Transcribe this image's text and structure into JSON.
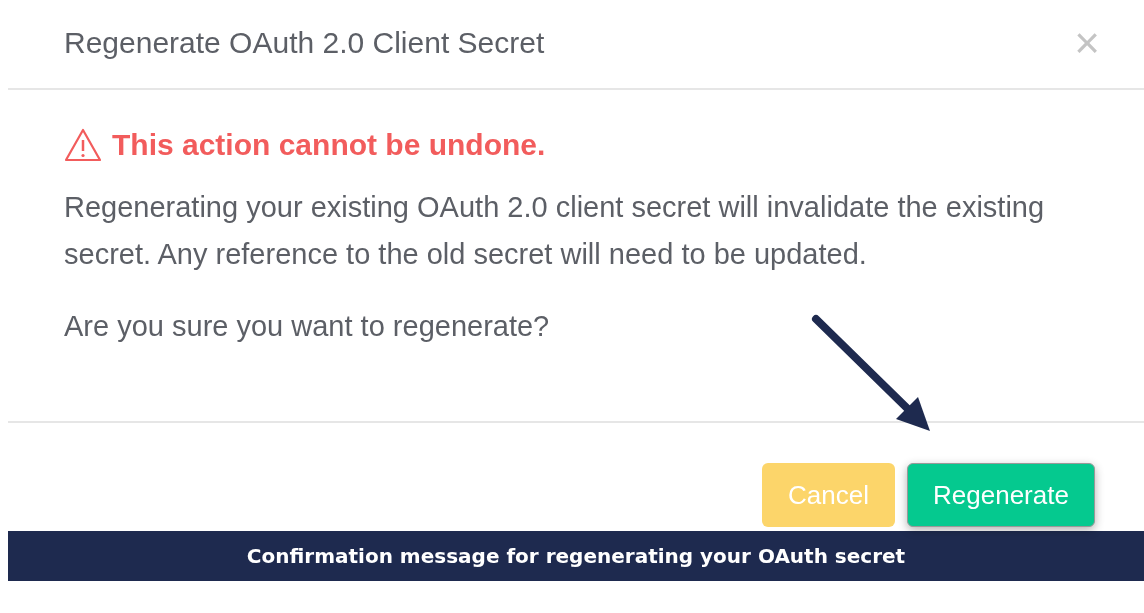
{
  "dialog": {
    "title": "Regenerate OAuth 2.0 Client Secret",
    "close": "×",
    "warning": "This action cannot be undone.",
    "message": "Regenerating your existing OAuth 2.0 client secret will invalidate the existing secret. Any reference to the old secret will need to be updated.",
    "question": "Are you sure you want to regenerate?",
    "buttons": [
      {
        "label": "Cancel",
        "kind": "cancel"
      },
      {
        "label": "Regenerate",
        "kind": "primary"
      }
    ]
  },
  "caption": "Confirmation message for regenerating your OAuth secret"
}
